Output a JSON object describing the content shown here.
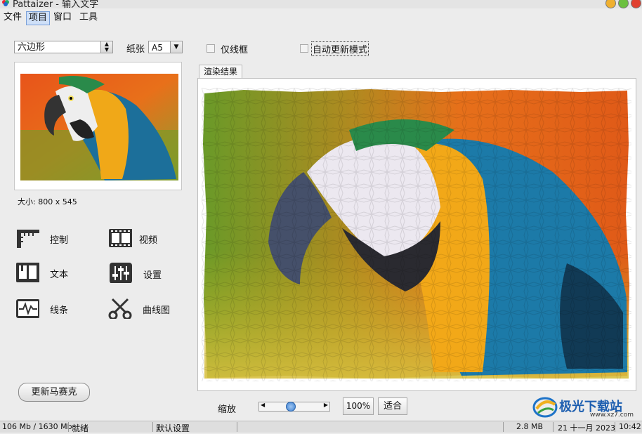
{
  "titlebar": {
    "title": "Pattaizer - 输入文字"
  },
  "menu": {
    "file": "文件",
    "project": "项目",
    "window": "窗口",
    "tools": "工具"
  },
  "options": {
    "shape_value": "六边形",
    "paper_label": "纸张",
    "paper_value": "A5",
    "wireframe_label": "仅线框",
    "auto_update_label": "自动更新模式"
  },
  "image_info": {
    "size": "大小: 800 x 545"
  },
  "tools": {
    "control": "控制",
    "video": "视频",
    "text": "文本",
    "settings": "设置",
    "lines": "线条",
    "curves": "曲线图"
  },
  "actions": {
    "update_mosaic": "更新马赛克"
  },
  "render": {
    "tab_label": "渲染结果"
  },
  "zoom": {
    "label": "缩放",
    "percent_button": "100%",
    "fit_button": "适合",
    "slider_level": 0.4
  },
  "status": {
    "memory": "106 Mb / 1630 Mb",
    "state": "就绪",
    "preset": "默认设置",
    "filesize": "2.8 MB",
    "date": "21 十一月 2023",
    "time": "10:42"
  },
  "watermark": {
    "text": "极光下载站",
    "url": "www.xz7.com"
  },
  "icons": [
    "app-logo-icon",
    "ruler-icon",
    "film-icon",
    "book-icon",
    "sliders-icon",
    "waveform-icon",
    "scissors-icon"
  ],
  "colors": {
    "orange": "#e8701a",
    "green": "#7aa022",
    "yellow": "#f0b020",
    "blue": "#1f7fb0"
  }
}
